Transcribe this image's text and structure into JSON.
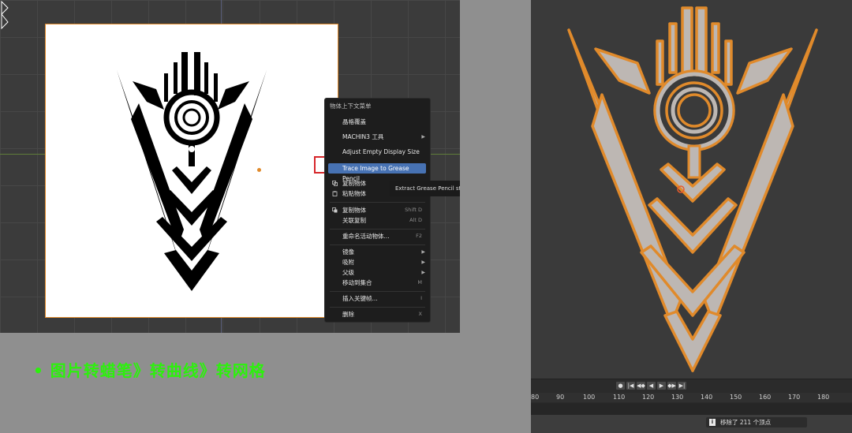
{
  "context_menu": {
    "title": "物体上下文菜单",
    "items": [
      {
        "label": "晶格覆盖",
        "shortcut": "",
        "submenu": false,
        "icon": ""
      },
      {
        "label": "MACHIN3 工具",
        "shortcut": "",
        "submenu": true,
        "icon": ""
      },
      {
        "label": "Adjust Empty Display Size",
        "shortcut": "",
        "submenu": false,
        "icon": ""
      },
      {
        "label": "Trace Image to Grease Pencil",
        "shortcut": "",
        "submenu": false,
        "icon": "",
        "highlighted": true
      },
      {
        "label": "复制物体",
        "shortcut": "",
        "submenu": false,
        "icon": "copy-icon"
      },
      {
        "label": "粘贴物体",
        "shortcut": "",
        "submenu": false,
        "icon": "paste-icon"
      },
      {
        "label": "复制物体",
        "shortcut": "Shift D",
        "submenu": false,
        "icon": "duplicate-icon"
      },
      {
        "label": "关联复制",
        "shortcut": "Alt D",
        "submenu": false,
        "icon": ""
      },
      {
        "label": "重命名活动物体...",
        "shortcut": "F2",
        "submenu": false,
        "icon": ""
      },
      {
        "label": "镜像",
        "shortcut": "",
        "submenu": true,
        "icon": ""
      },
      {
        "label": "吸附",
        "shortcut": "",
        "submenu": true,
        "icon": ""
      },
      {
        "label": "父级",
        "shortcut": "",
        "submenu": true,
        "icon": ""
      },
      {
        "label": "移动到集合",
        "shortcut": "M",
        "submenu": false,
        "icon": ""
      },
      {
        "label": "插入关键帧...",
        "shortcut": "I",
        "submenu": false,
        "icon": ""
      },
      {
        "label": "删除",
        "shortcut": "X",
        "submenu": false,
        "icon": ""
      }
    ]
  },
  "tooltip": {
    "text": "Extract Grease Pencil st"
  },
  "caption": {
    "text": "• 图片转蜡笔》转曲线》转网格"
  },
  "timeline": {
    "ticks": [
      "80",
      "90",
      "100",
      "110",
      "120",
      "130",
      "140",
      "150",
      "160",
      "170",
      "180"
    ],
    "buttons": [
      "●",
      "|◀",
      "◀◆",
      "◀",
      "▶",
      "◆▶",
      "▶|"
    ]
  },
  "status": {
    "text": "移除了 211 个顶点"
  },
  "colors": {
    "accent": "#4772b3",
    "outline": "#e08a2b",
    "caption": "#2cf10c",
    "highlight_box": "#d6262a"
  }
}
